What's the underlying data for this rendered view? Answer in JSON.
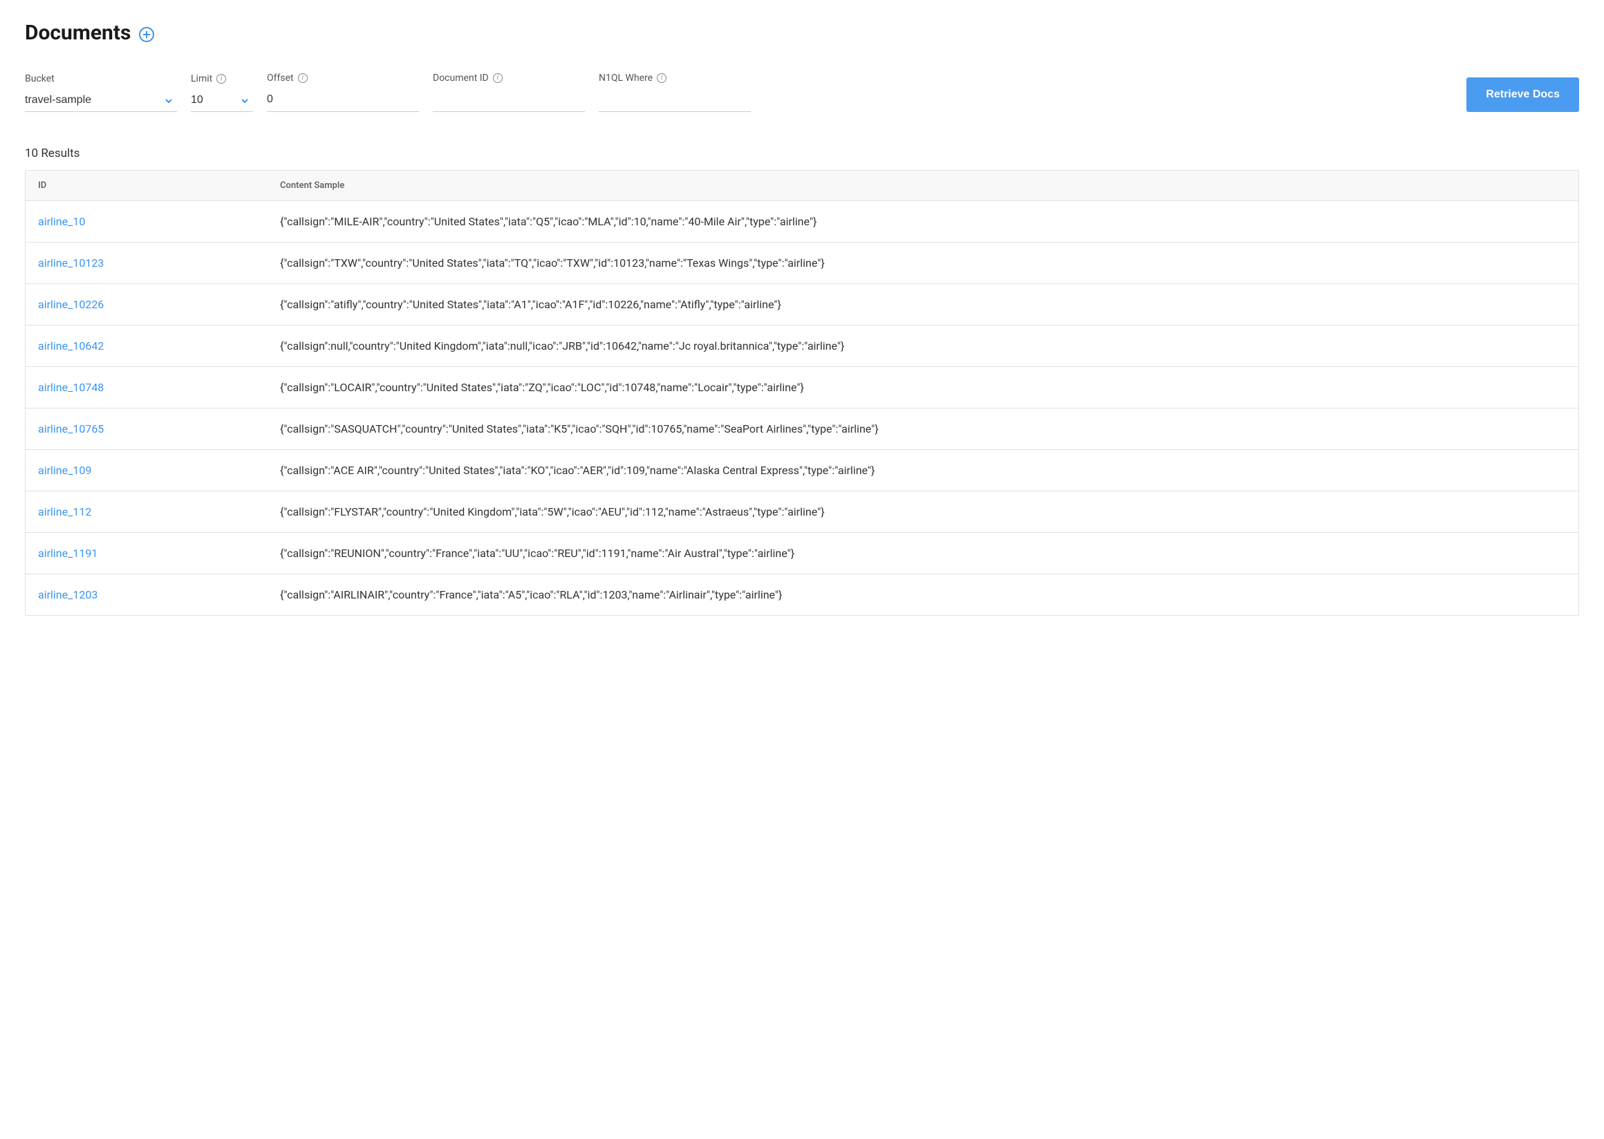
{
  "header": {
    "title": "Documents"
  },
  "filters": {
    "bucket": {
      "label": "Bucket",
      "value": "travel-sample"
    },
    "limit": {
      "label": "Limit",
      "value": "10"
    },
    "offset": {
      "label": "Offset",
      "value": "0"
    },
    "document_id": {
      "label": "Document ID",
      "value": ""
    },
    "where": {
      "label": "N1QL Where",
      "value": ""
    },
    "retrieve_button": "Retrieve Docs"
  },
  "results": {
    "summary": "10 Results",
    "columns": {
      "id": "ID",
      "content": "Content Sample"
    },
    "rows": [
      {
        "id": "airline_10",
        "content": "{\"callsign\":\"MILE-AIR\",\"country\":\"United States\",\"iata\":\"Q5\",\"icao\":\"MLA\",\"id\":10,\"name\":\"40-Mile Air\",\"type\":\"airline\"}"
      },
      {
        "id": "airline_10123",
        "content": "{\"callsign\":\"TXW\",\"country\":\"United States\",\"iata\":\"TQ\",\"icao\":\"TXW\",\"id\":10123,\"name\":\"Texas Wings\",\"type\":\"airline\"}"
      },
      {
        "id": "airline_10226",
        "content": "{\"callsign\":\"atifly\",\"country\":\"United States\",\"iata\":\"A1\",\"icao\":\"A1F\",\"id\":10226,\"name\":\"Atifly\",\"type\":\"airline\"}"
      },
      {
        "id": "airline_10642",
        "content": "{\"callsign\":null,\"country\":\"United Kingdom\",\"iata\":null,\"icao\":\"JRB\",\"id\":10642,\"name\":\"Jc royal.britannica\",\"type\":\"airline\"}"
      },
      {
        "id": "airline_10748",
        "content": "{\"callsign\":\"LOCAIR\",\"country\":\"United States\",\"iata\":\"ZQ\",\"icao\":\"LOC\",\"id\":10748,\"name\":\"Locair\",\"type\":\"airline\"}"
      },
      {
        "id": "airline_10765",
        "content": "{\"callsign\":\"SASQUATCH\",\"country\":\"United States\",\"iata\":\"K5\",\"icao\":\"SQH\",\"id\":10765,\"name\":\"SeaPort Airlines\",\"type\":\"airline\"}"
      },
      {
        "id": "airline_109",
        "content": "{\"callsign\":\"ACE AIR\",\"country\":\"United States\",\"iata\":\"KO\",\"icao\":\"AER\",\"id\":109,\"name\":\"Alaska Central Express\",\"type\":\"airline\"}"
      },
      {
        "id": "airline_112",
        "content": "{\"callsign\":\"FLYSTAR\",\"country\":\"United Kingdom\",\"iata\":\"5W\",\"icao\":\"AEU\",\"id\":112,\"name\":\"Astraeus\",\"type\":\"airline\"}"
      },
      {
        "id": "airline_1191",
        "content": "{\"callsign\":\"REUNION\",\"country\":\"France\",\"iata\":\"UU\",\"icao\":\"REU\",\"id\":1191,\"name\":\"Air Austral\",\"type\":\"airline\"}"
      },
      {
        "id": "airline_1203",
        "content": "{\"callsign\":\"AIRLINAIR\",\"country\":\"France\",\"iata\":\"A5\",\"icao\":\"RLA\",\"id\":1203,\"name\":\"Airlinair\",\"type\":\"airline\"}"
      }
    ]
  }
}
